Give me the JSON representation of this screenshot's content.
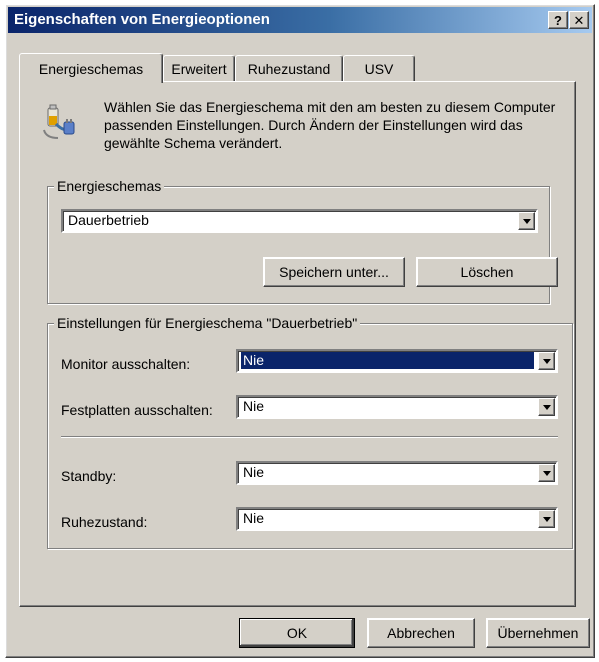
{
  "window": {
    "title": "Eigenschaften von Energieoptionen",
    "help_label": "?",
    "close_label": "✕"
  },
  "tabs": [
    {
      "label": "Energieschemas",
      "active": true
    },
    {
      "label": "Erweitert",
      "active": false
    },
    {
      "label": "Ruhezustand",
      "active": false
    },
    {
      "label": "USV",
      "active": false
    }
  ],
  "intro": {
    "icon": "power-plug-battery-icon",
    "text": "Wählen Sie das Energieschema mit den am besten zu diesem Computer passenden Einstellungen. Durch Ändern der Einstellungen wird das gewählte Schema verändert."
  },
  "schemes": {
    "legend": "Energieschemas",
    "selected": "Dauerbetrieb",
    "save_label": "Speichern unter...",
    "delete_label": "Löschen"
  },
  "settings": {
    "legend": "Einstellungen für Energieschema \"Dauerbetrieb\"",
    "monitor": {
      "label": "Monitor ausschalten:",
      "value": "Nie"
    },
    "disks": {
      "label": "Festplatten ausschalten:",
      "value": "Nie"
    },
    "standby": {
      "label": "Standby:",
      "value": "Nie"
    },
    "hibernate": {
      "label": "Ruhezustand:",
      "value": "Nie"
    }
  },
  "footer": {
    "ok_label": "OK",
    "cancel_label": "Abbrechen",
    "apply_label": "Übernehmen"
  }
}
